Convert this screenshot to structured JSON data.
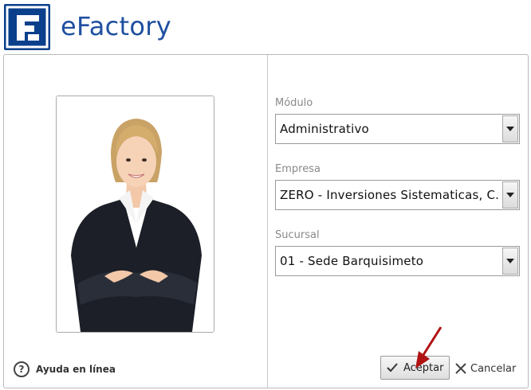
{
  "app": {
    "title": "eFactory"
  },
  "form": {
    "modulo": {
      "label": "Módulo",
      "value": "Administrativo"
    },
    "empresa": {
      "label": "Empresa",
      "value": "ZERO - Inversiones Sistematicas, C.A."
    },
    "sucursal": {
      "label": "Sucursal",
      "value": "01 - Sede Barquisimeto"
    }
  },
  "help": {
    "icon": "question-circle-icon",
    "label": "Ayuda en línea"
  },
  "actions": {
    "accept": {
      "icon": "checkmark-icon",
      "label": "Aceptar"
    },
    "cancel": {
      "icon": "close-icon",
      "label": "Cancelar"
    }
  },
  "colors": {
    "brand": "#0a3f8c",
    "title": "#1f4fa0",
    "arrow": "#b01212"
  }
}
